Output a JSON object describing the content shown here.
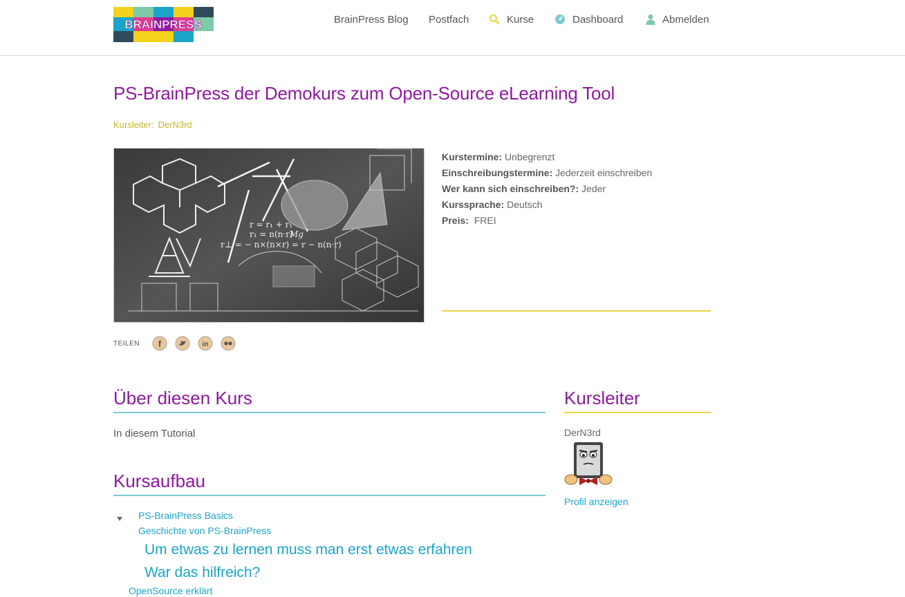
{
  "brand": {
    "logo_text": "BRAINPRESS",
    "colors": {
      "purple": "#8e1b9e",
      "teal": "#1aa5c8",
      "yellow": "#e6d744",
      "olive": "#c7b62a"
    }
  },
  "nav": {
    "items": [
      {
        "label": "BrainPress Blog",
        "icon": ""
      },
      {
        "label": "Postfach",
        "icon": ""
      },
      {
        "label": "Kurse",
        "icon": "search-icon"
      },
      {
        "label": "Dashboard",
        "icon": "dashboard-icon"
      },
      {
        "label": "Abmelden",
        "icon": "user-icon"
      }
    ]
  },
  "course": {
    "title": "PS-BrainPress der Demokurs zum Open-Source eLearning Tool",
    "instructor_label": "Kursleiter:",
    "instructor_name": "DerN3rd",
    "details": [
      {
        "key": "Kurstermine:",
        "value": "Unbegrenzt"
      },
      {
        "key": "Einschreibungstermine:",
        "value": "Jederzeit einschreiben"
      },
      {
        "key": "Wer kann sich einschreiben?:",
        "value": "Jeder"
      },
      {
        "key": "Kurssprache:",
        "value": "Deutsch"
      },
      {
        "key": "Preis:",
        "value": "FREI"
      }
    ],
    "image_formulas": [
      "r = r₁ + r₁",
      "r₁ = n(n·r)",
      "r⊥ = − n×(n×r) = r − n(n·r)",
      "Mg"
    ]
  },
  "share": {
    "label": "TEILEN",
    "icons": [
      "facebook-icon",
      "twitter-icon",
      "linkedin-icon",
      "flickr-icon"
    ]
  },
  "about": {
    "title": "Über diesen Kurs",
    "text": "In diesem Tutorial"
  },
  "structure": {
    "title": "Kursaufbau",
    "items": [
      {
        "label": "PS-BrainPress Basics"
      },
      {
        "label": "Geschichte von PS-BrainPress"
      },
      {
        "label": "Um etwas zu lernen muss man erst etwas erfahren"
      },
      {
        "label": "War das hilfreich?"
      },
      {
        "label": "OpenSource erklärt"
      }
    ]
  },
  "sidebar": {
    "title": "Kursleiter",
    "name": "DerN3rd",
    "profile_link": "Profil anzeigen"
  }
}
